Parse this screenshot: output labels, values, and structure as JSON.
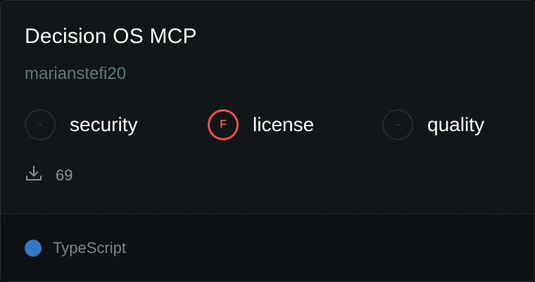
{
  "package": {
    "name": "Decision OS MCP",
    "owner": "marianstefi20"
  },
  "scores": [
    {
      "label": "security",
      "grade": "-",
      "status": "none"
    },
    {
      "label": "license",
      "grade": "F",
      "status": "fail"
    },
    {
      "label": "quality",
      "grade": "-",
      "status": "none"
    }
  ],
  "downloads": {
    "icon": "download-icon",
    "count": "69"
  },
  "language": {
    "name": "TypeScript",
    "color": "#3178c6"
  },
  "colors": {
    "fail": "#f04e4e",
    "background": "#111618"
  }
}
